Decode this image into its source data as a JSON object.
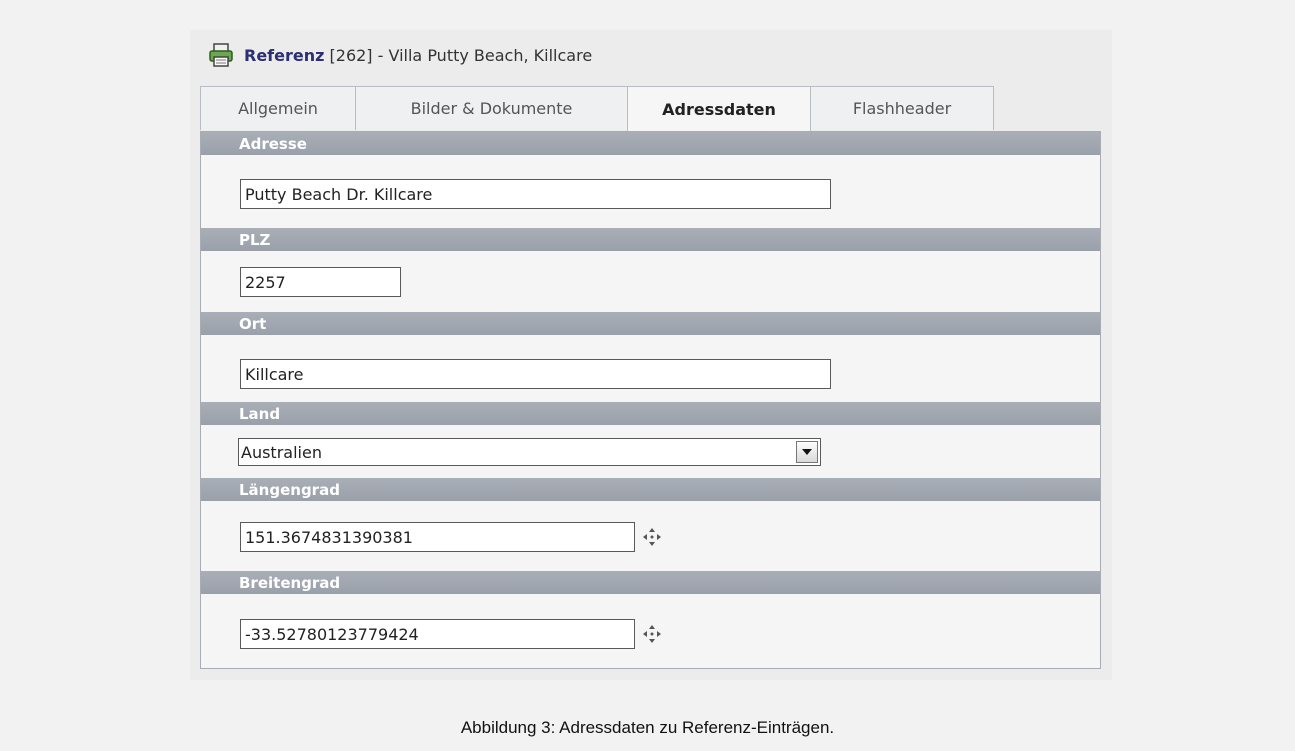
{
  "title": {
    "strong": "Referenz",
    "rest": " [262] - Villa Putty Beach, Killcare"
  },
  "tabs": [
    {
      "label": "Allgemein",
      "active": false
    },
    {
      "label": "Bilder & Dokumente",
      "active": false
    },
    {
      "label": "Adressdaten",
      "active": true
    },
    {
      "label": "Flashheader",
      "active": false
    }
  ],
  "fields": {
    "adresse": {
      "label": "Adresse",
      "value": "Putty Beach Dr. Killcare"
    },
    "plz": {
      "label": "PLZ",
      "value": "2257"
    },
    "ort": {
      "label": "Ort",
      "value": "Killcare"
    },
    "land": {
      "label": "Land",
      "value": "Australien"
    },
    "laengengrad": {
      "label": "Längengrad",
      "value": "151.3674831390381"
    },
    "breitengrad": {
      "label": "Breitengrad",
      "value": "-33.52780123779424"
    }
  },
  "icons": {
    "title": "printer-icon",
    "move": "move-arrows-icon",
    "dropdown": "chevron-down-icon"
  },
  "caption": "Abbildung 3: Adressdaten zu Referenz-Einträgen."
}
